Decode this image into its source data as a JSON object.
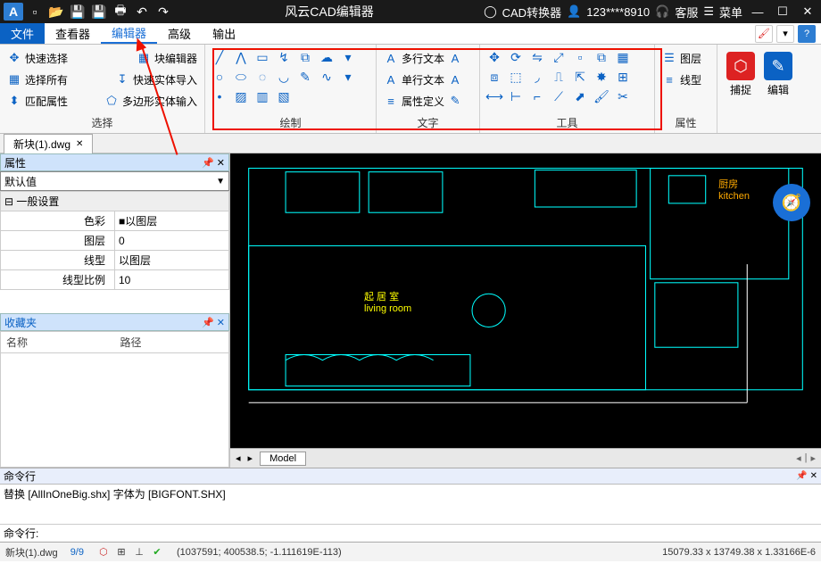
{
  "title": "风云CAD编辑器",
  "titlebar_right": {
    "converter": "CAD转换器",
    "user": "123****8910",
    "support": "客服",
    "menu": "菜单"
  },
  "menubar": [
    "文件",
    "查看器",
    "编辑器",
    "高级",
    "输出"
  ],
  "ribbon": {
    "p1": {
      "i1": "快速选择",
      "i2": "选择所有",
      "i3": "匹配属性",
      "i4": "块编辑器",
      "i5": "快速实体导入",
      "i6": "多边形实体输入",
      "label": "选择"
    },
    "p2": {
      "label": "绘制"
    },
    "p3": {
      "i1": "多行文本",
      "i2": "单行文本",
      "i3": "属性定义",
      "label": "文字"
    },
    "p4": {
      "label": "工具"
    },
    "p5": {
      "i1": "图层",
      "i2": "线型",
      "label": "属性"
    },
    "p6": {
      "b1": "捕捉",
      "b2": "编辑"
    }
  },
  "doctab": "新块(1).dwg",
  "props": {
    "header": "属性",
    "default": "默认值",
    "group": "一般设置",
    "r1k": "色彩",
    "r1v": "以图层",
    "r2k": "图层",
    "r2v": "0",
    "r3k": "线型",
    "r3v": "以图层",
    "r4k": "线型比例",
    "r4v": "10"
  },
  "fav": {
    "header": "收藏夹",
    "c1": "名称",
    "c2": "路径"
  },
  "canvas": {
    "room_cn": "起 居 室",
    "room_en": "living room",
    "kitchen_cn": "厨房",
    "kitchen_en": "kitchen"
  },
  "modeltab": "Model",
  "cmd": {
    "header": "命令行",
    "history": "替换 [AllInOneBig.shx] 字体为 [BIGFONT.SHX]",
    "prompt": "命令行:"
  },
  "status": {
    "file": "新块(1).dwg",
    "prog": "9/9",
    "coords": "(1037591; 400538.5; -1.111619E-113)",
    "zoom": "15079.33 x 13749.38 x 1.33166E-6"
  }
}
